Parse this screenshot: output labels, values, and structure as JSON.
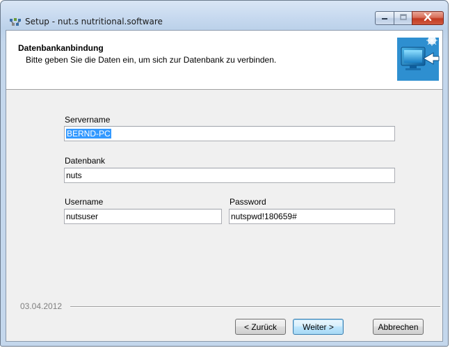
{
  "window": {
    "title": "Setup - nut.s nutritional.software",
    "icon": "setup-app-icon"
  },
  "header": {
    "title": "Datenbankanbindung",
    "subtitle": "Bitte geben Sie die Daten ein, um sich zur Datenbank zu verbinden.",
    "image": "computer-database-wizard-image"
  },
  "form": {
    "servername": {
      "label": "Servername",
      "value": "BERND-PC",
      "selected": true
    },
    "datenbank": {
      "label": "Datenbank",
      "value": "nuts"
    },
    "username": {
      "label": "Username",
      "value": "nutsuser"
    },
    "password": {
      "label": "Password",
      "value": "nutspwd!180659#"
    }
  },
  "footer": {
    "date": "03.04.2012",
    "back_label": "< Zurück",
    "next_label": "Weiter >",
    "cancel_label": "Abbrechen"
  },
  "colors": {
    "selection": "#3399ff",
    "close_button": "#c23b22",
    "default_button_border": "#3c7fb1"
  }
}
